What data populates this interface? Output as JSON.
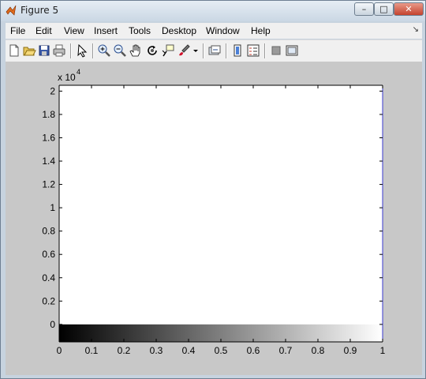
{
  "window": {
    "title": "Figure 5",
    "controls": {
      "minimize": "–",
      "maximize": "□",
      "close": "✕"
    }
  },
  "menu": [
    "File",
    "Edit",
    "View",
    "Insert",
    "Tools",
    "Desktop",
    "Window",
    "Help"
  ],
  "toolbar": {
    "buttons": [
      "new-figure-icon",
      "open-file-icon",
      "save-icon",
      "print-icon",
      "edit-plot-arrow-icon",
      "zoom-in-icon",
      "zoom-out-icon",
      "pan-hand-icon",
      "rotate-3d-icon",
      "data-cursor-icon",
      "brush-icon",
      "brush-dropdown-icon",
      "link-plot-icon",
      "insert-colorbar-icon",
      "insert-legend-icon",
      "hide-plot-tools-icon",
      "show-plot-tools-icon"
    ]
  },
  "chart_data": {
    "type": "heatmap",
    "colormap": "gray",
    "title": "",
    "xlabel": "",
    "ylabel": "",
    "y_exponent_label": "x 10",
    "y_exponent": "4",
    "xlim": [
      0,
      1
    ],
    "ylim": [
      -1500,
      20500
    ],
    "x_ticks": [
      "0",
      "0.1",
      "0.2",
      "0.3",
      "0.4",
      "0.5",
      "0.6",
      "0.7",
      "0.8",
      "0.9",
      "1"
    ],
    "x_tick_values": [
      0,
      0.1,
      0.2,
      0.3,
      0.4,
      0.5,
      0.6,
      0.7,
      0.8,
      0.9,
      1
    ],
    "y_ticks": [
      "0",
      "0.2",
      "0.4",
      "0.6",
      "0.8",
      "1",
      "1.2",
      "1.4",
      "1.6",
      "1.8",
      "2"
    ],
    "y_tick_values": [
      0,
      2000,
      4000,
      6000,
      8000,
      10000,
      12000,
      14000,
      16000,
      18000,
      20000
    ],
    "gradient_band": {
      "y_from": -1500,
      "y_to": 0,
      "x_from": 0,
      "x_to": 1,
      "color_from": "#000000",
      "color_to": "#ffffff"
    },
    "grid": false
  },
  "colors": {
    "figure_bg": "#c8c8c8",
    "axes_bg": "#ffffff",
    "axis_right_edge": "#3a3ad0"
  }
}
